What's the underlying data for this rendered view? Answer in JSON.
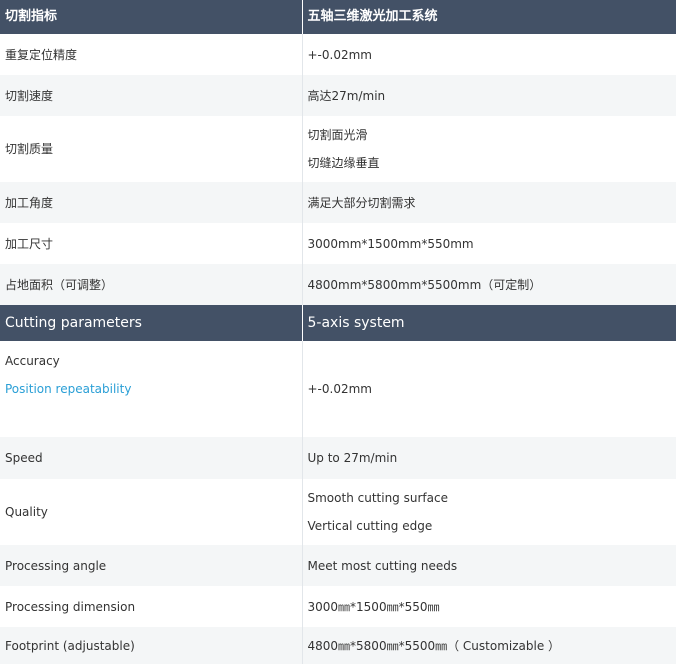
{
  "zh_table": {
    "header": {
      "param": "切割指标",
      "system": "五轴三维激光加工系统"
    },
    "rows": [
      {
        "label": "重复定位精度",
        "value": "+-0.02mm"
      },
      {
        "label": "切割速度",
        "value": "高达27m/min"
      },
      {
        "label": "切割质量",
        "lines": [
          "切割面光滑",
          "切缝边缘垂直"
        ]
      },
      {
        "label": "加工角度",
        "value": "满足大部分切割需求"
      },
      {
        "label": "加工尺寸",
        "value": "3000mm*1500mm*550mm"
      },
      {
        "label": "占地面积（可调整）",
        "value": "4800mm*5800mm*5500mm（可定制）"
      }
    ]
  },
  "en_table": {
    "header": {
      "param": "Cutting parameters",
      "system": "5-axis system"
    },
    "rows": [
      {
        "lines": [
          "Accuracy",
          "Position repeatability"
        ],
        "value": "+-0.02mm"
      },
      {
        "label": "Speed",
        "value": "Up to 27m/min"
      },
      {
        "label": "Quality",
        "lines": [
          "Smooth cutting surface",
          "Vertical cutting edge"
        ]
      },
      {
        "label": "Processing angle",
        "value": "Meet most cutting needs"
      },
      {
        "label": "Processing dimension",
        "value": "3000㎜*1500㎜*550㎜"
      },
      {
        "label": "Footprint (adjustable)",
        "value": "4800㎜*5800㎜*5500㎜（ Customizable ）"
      }
    ]
  },
  "colors": {
    "header_bg": "#435166",
    "link": "#2a9fd6",
    "stripe": "#f4f6f7"
  }
}
